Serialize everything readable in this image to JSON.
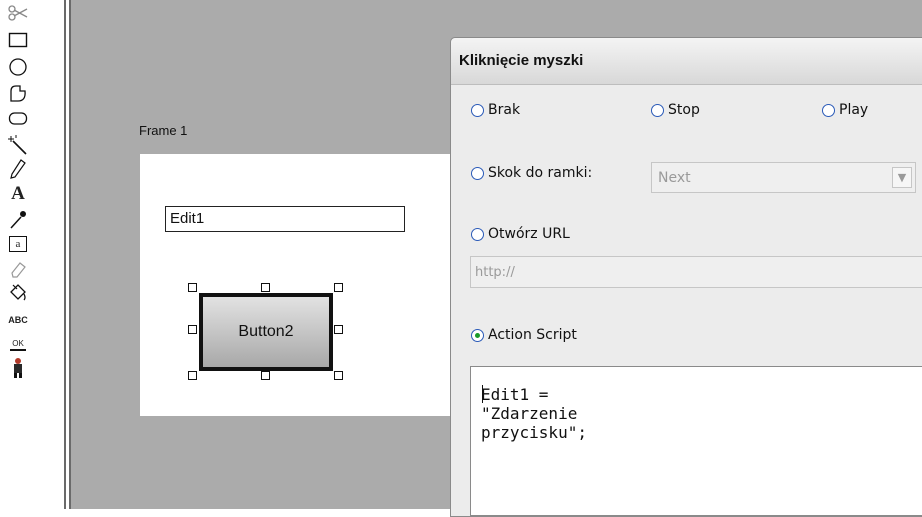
{
  "tools": [
    {
      "name": "scissors-icon"
    },
    {
      "name": "rectangle-icon"
    },
    {
      "name": "ellipse-icon"
    },
    {
      "name": "polygon-icon"
    },
    {
      "name": "rounded-rectangle-icon"
    },
    {
      "name": "magic-wand-icon"
    },
    {
      "name": "pencil-icon"
    },
    {
      "name": "text-tool-icon",
      "label": "A"
    },
    {
      "name": "eyedropper-icon"
    },
    {
      "name": "edit-field-tool-icon",
      "label": "a"
    },
    {
      "name": "eraser-icon"
    },
    {
      "name": "paint-bucket-icon"
    },
    {
      "name": "spellcheck-icon",
      "label": "ABC"
    },
    {
      "name": "ok-button-tool-icon",
      "label": "OK"
    },
    {
      "name": "character-icon"
    }
  ],
  "stage": {
    "frame_label": "Frame 1",
    "edit_text": "Edit1",
    "button_text": "Button2"
  },
  "dialog": {
    "title": "Kliknięcie myszki",
    "options": {
      "brak": "Brak",
      "stop": "Stop",
      "play": "Play",
      "skok": "Skok do ramki:",
      "url": "Otwórz URL",
      "script": "Action Script"
    },
    "selected": "script",
    "frame_select_value": "Next",
    "url_placeholder": "http://",
    "script_code": "Edit1 = \"Zdarzenie przycisku\";"
  },
  "colors": {
    "workspace": "#ababab",
    "dialog_bg": "#ececec",
    "radio_selected": "#1a9a2a"
  }
}
